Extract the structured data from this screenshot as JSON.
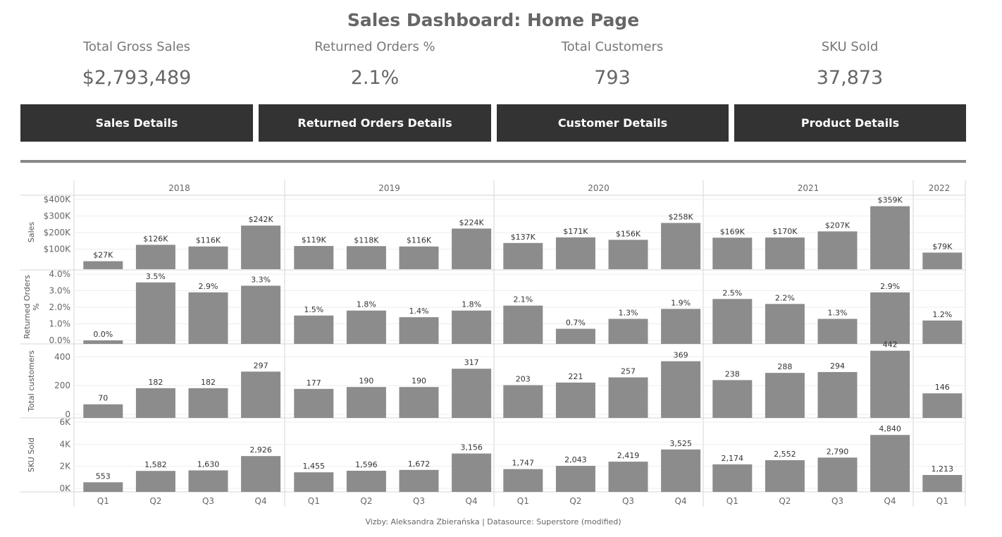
{
  "title": "Sales Dashboard: Home Page",
  "kpis": [
    {
      "label": "Total Gross Sales",
      "value": "$2,793,489"
    },
    {
      "label": "Returned Orders %",
      "value": "2.1%"
    },
    {
      "label": "Total Customers",
      "value": "793"
    },
    {
      "label": "SKU Sold",
      "value": "37,873"
    }
  ],
  "buttons": [
    "Sales Details",
    "Returned Orders Details",
    "Customer Details",
    "Product Details"
  ],
  "footer": "Vizby: Aleksandra Zbierańska | Datasource: Superstore (modified)",
  "colors": {
    "bar": "#8c8c8c",
    "button": "#333333",
    "divider": "#888888"
  },
  "chart_data": {
    "type": "bar",
    "years": [
      "2018",
      "2019",
      "2020",
      "2021",
      "2022"
    ],
    "categories": [
      {
        "year": "2018",
        "quarter": "Q1"
      },
      {
        "year": "2018",
        "quarter": "Q2"
      },
      {
        "year": "2018",
        "quarter": "Q3"
      },
      {
        "year": "2018",
        "quarter": "Q4"
      },
      {
        "year": "2019",
        "quarter": "Q1"
      },
      {
        "year": "2019",
        "quarter": "Q2"
      },
      {
        "year": "2019",
        "quarter": "Q3"
      },
      {
        "year": "2019",
        "quarter": "Q4"
      },
      {
        "year": "2020",
        "quarter": "Q1"
      },
      {
        "year": "2020",
        "quarter": "Q2"
      },
      {
        "year": "2020",
        "quarter": "Q3"
      },
      {
        "year": "2020",
        "quarter": "Q4"
      },
      {
        "year": "2021",
        "quarter": "Q1"
      },
      {
        "year": "2021",
        "quarter": "Q2"
      },
      {
        "year": "2021",
        "quarter": "Q3"
      },
      {
        "year": "2021",
        "quarter": "Q4"
      },
      {
        "year": "2022",
        "quarter": "Q1"
      }
    ],
    "grid": true,
    "series": [
      {
        "name": "Sales",
        "ylabel": "Sales",
        "ylim": [
          0,
          400000
        ],
        "ticks": [
          {
            "v": 100000,
            "label": "$100K"
          },
          {
            "v": 200000,
            "label": "$200K"
          },
          {
            "v": 300000,
            "label": "$300K"
          },
          {
            "v": 400000,
            "label": "$400K"
          }
        ],
        "values": [
          27000,
          126000,
          116000,
          242000,
          119000,
          118000,
          116000,
          224000,
          137000,
          171000,
          156000,
          258000,
          169000,
          170000,
          207000,
          359000,
          79000
        ],
        "labels": [
          "$27K",
          "$126K",
          "$116K",
          "$242K",
          "$119K",
          "$118K",
          "$116K",
          "$224K",
          "$137K",
          "$171K",
          "$156K",
          "$258K",
          "$169K",
          "$170K",
          "$207K",
          "$359K",
          "$79K"
        ]
      },
      {
        "name": "Returned Orders %",
        "ylabel": "Returned Orders %",
        "ylim": [
          0,
          4.0
        ],
        "ticks": [
          {
            "v": 0,
            "label": "0.0%"
          },
          {
            "v": 1.0,
            "label": "1.0%"
          },
          {
            "v": 2.0,
            "label": "2.0%"
          },
          {
            "v": 3.0,
            "label": "3.0%"
          },
          {
            "v": 4.0,
            "label": "4.0%"
          }
        ],
        "values": [
          0.0,
          3.5,
          2.9,
          3.3,
          1.5,
          1.8,
          1.4,
          1.8,
          2.1,
          0.7,
          1.3,
          1.9,
          2.5,
          2.2,
          1.3,
          2.9,
          1.2
        ],
        "labels": [
          "0.0%",
          "3.5%",
          "2.9%",
          "3.3%",
          "1.5%",
          "1.8%",
          "1.4%",
          "1.8%",
          "2.1%",
          "0.7%",
          "1.3%",
          "1.9%",
          "2.5%",
          "2.2%",
          "1.3%",
          "2.9%",
          "1.2%"
        ]
      },
      {
        "name": "Total customers",
        "ylabel": "Total customers",
        "ylim": [
          0,
          460
        ],
        "ticks": [
          {
            "v": 0,
            "label": "0"
          },
          {
            "v": 200,
            "label": "200"
          },
          {
            "v": 400,
            "label": "400"
          }
        ],
        "values": [
          70,
          182,
          182,
          297,
          177,
          190,
          190,
          317,
          203,
          221,
          257,
          369,
          238,
          288,
          294,
          442,
          146
        ],
        "labels": [
          "70",
          "182",
          "182",
          "297",
          "177",
          "190",
          "190",
          "317",
          "203",
          "221",
          "257",
          "369",
          "238",
          "288",
          "294",
          "442",
          "146"
        ]
      },
      {
        "name": "SKU Sold",
        "ylabel": "SKU Sold",
        "ylim": [
          0,
          6000
        ],
        "ticks": [
          {
            "v": 0,
            "label": "0K"
          },
          {
            "v": 2000,
            "label": "2K"
          },
          {
            "v": 4000,
            "label": "4K"
          },
          {
            "v": 6000,
            "label": "6K"
          }
        ],
        "values": [
          553,
          1582,
          1630,
          2926,
          1455,
          1596,
          1672,
          3156,
          1747,
          2043,
          2419,
          3525,
          2174,
          2552,
          2790,
          4840,
          1213
        ],
        "labels": [
          "553",
          "1,582",
          "1,630",
          "2,926",
          "1,455",
          "1,596",
          "1,672",
          "3,156",
          "1,747",
          "2,043",
          "2,419",
          "3,525",
          "2,174",
          "2,552",
          "2,790",
          "4,840",
          "1,213"
        ]
      }
    ]
  }
}
